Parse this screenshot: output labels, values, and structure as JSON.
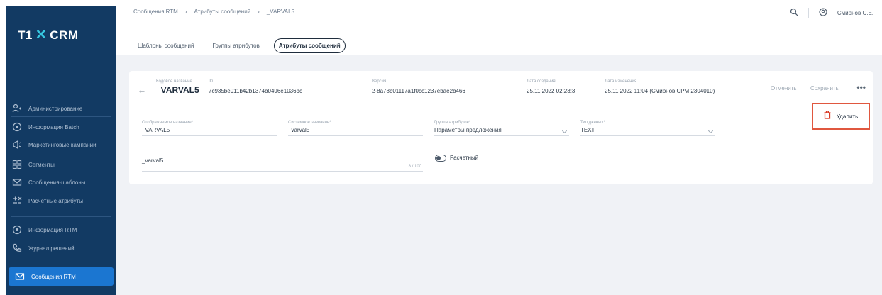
{
  "app": {
    "logo_text": "T1",
    "logo_suffix": "CRM"
  },
  "sidebar": {
    "items": [
      {
        "label": "Администрирование",
        "icon": "admin-icon"
      },
      {
        "label": "Информация Batch",
        "icon": "info-batch-icon"
      },
      {
        "label": "Маркетинговые кампании",
        "icon": "megaphone-icon"
      },
      {
        "label": "Сегменты",
        "icon": "segments-icon"
      },
      {
        "label": "Сообщения-шаблоны",
        "icon": "message-template-icon"
      },
      {
        "label": "Расчетные атрибуты",
        "icon": "calc-attr-icon"
      },
      {
        "label": "Информация RTM",
        "icon": "info-rtm-icon"
      },
      {
        "label": "Журнал решений",
        "icon": "phone-icon"
      },
      {
        "label": "Сообщения RTM",
        "icon": "message-rtm-icon"
      }
    ]
  },
  "header": {
    "breadcrumb": [
      "Сообщения RTM",
      "Атрибуты сообщений",
      "_VARVAL5"
    ],
    "user": "Смирнов С.Е."
  },
  "tabs": [
    "Шаблоны сообщений",
    "Группы атрибутов",
    "Атрибуты сообщений"
  ],
  "card": {
    "name_caption": "Кодовое название",
    "name": "_VARVAL5",
    "id_caption": "ID",
    "id_value": "7c935be911b42b1374b0496e1036bc",
    "version_caption": "Версия",
    "version_value": "2-8a78b01117a1f0cc1237ebae2b466",
    "created_caption": "Дата создания",
    "created_value": "25.11.2022 02:23:3",
    "modified_caption": "Дата изменения",
    "modified_value": "25.11.2022 11:04 (Смирнов СРМ 2304010)",
    "cancel_label": "Отменить",
    "save_label": "Сохранить",
    "more_label": "•••",
    "delete_label": "Удалить"
  },
  "form": {
    "display_name_caption": "Отображаемое название*",
    "display_name_value": "_VARVAL5",
    "system_name_caption": "Системное название*",
    "system_name_value": "_varval5",
    "group_caption": "Группа атрибутов*",
    "group_value": "Параметры предложения",
    "type_caption": "Тип данных*",
    "type_value": "TEXT",
    "description_value": "_varval5",
    "description_counter": "8 / 100",
    "toggle_label": "Расчетный"
  }
}
